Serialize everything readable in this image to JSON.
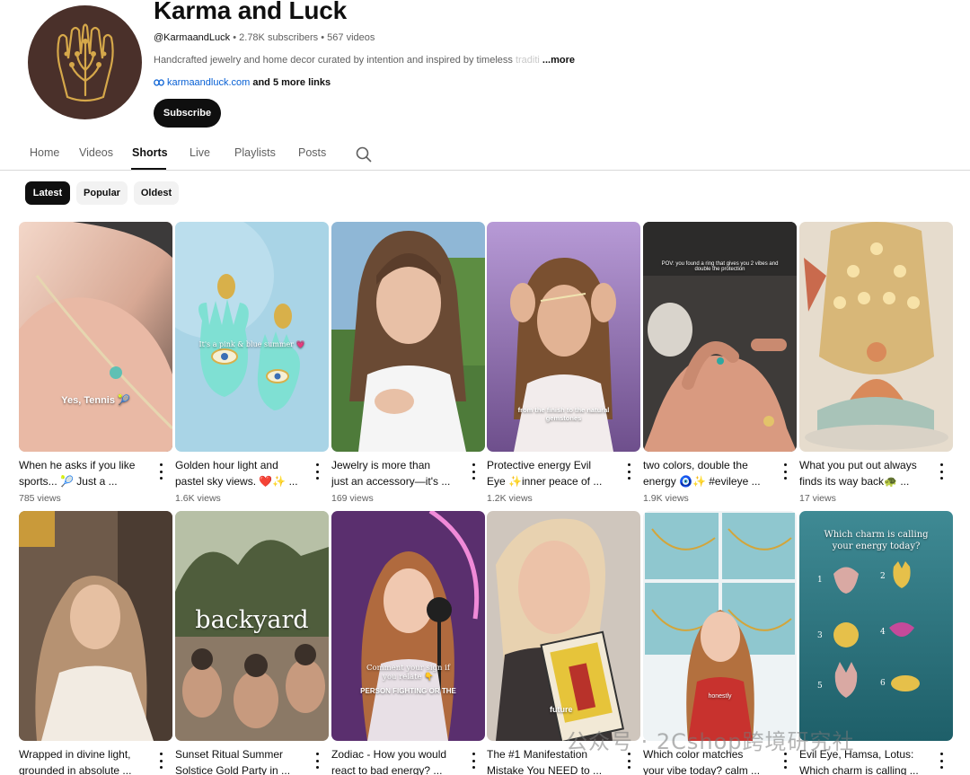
{
  "channel": {
    "name": "Karma and Luck",
    "handle": "@KarmaandLuck",
    "subscribers": "2.78K subscribers",
    "videos": "567 videos",
    "description_visible": "Handcrafted jewelry and home decor curated by intention and inspired by timeless ",
    "description_fade": "traditi",
    "more_label": "...more",
    "link_url": "karmaandluck.com",
    "link_more": "and 5 more links",
    "subscribe_label": "Subscribe",
    "avatar_icon": "hamsa-tree-logo-icon"
  },
  "tabs": [
    {
      "label": "Home"
    },
    {
      "label": "Videos"
    },
    {
      "label": "Shorts",
      "active": true
    },
    {
      "label": "Live"
    },
    {
      "label": "Playlists"
    },
    {
      "label": "Posts"
    }
  ],
  "filters": [
    {
      "label": "Latest",
      "active": true
    },
    {
      "label": "Popular"
    },
    {
      "label": "Oldest"
    }
  ],
  "shorts": [
    {
      "line1": "When he asks if you like",
      "line2": "sports... 🎾 Just a ...",
      "views": "785 views",
      "overlay": "Yes, Tennis 🎾"
    },
    {
      "line1": "Golden hour light and",
      "line2": "pastel sky views. ❤️✨ ...",
      "views": "1.6K views",
      "overlay": "It's a pink & blue summer 💗"
    },
    {
      "line1": "Jewelry is more than",
      "line2": "just an accessory—it's ...",
      "views": "169 views",
      "overlay": ""
    },
    {
      "line1": "Protective energy Evil",
      "line2": "Eye ✨inner peace of ...",
      "views": "1.2K views",
      "overlay": "from the finish to the natural gemstones"
    },
    {
      "line1": "two colors, double the",
      "line2": "energy 🧿✨ #evileye ...",
      "views": "1.9K views",
      "overlay": "POV: you found a ring that gives you 2 vibes and double the protection"
    },
    {
      "line1": "What you put out always",
      "line2": "finds its way back🐢 ...",
      "views": "17 views",
      "overlay": ""
    },
    {
      "line1": "Wrapped in divine light,",
      "line2": "grounded in absolute ...",
      "views": "",
      "overlay": ""
    },
    {
      "line1": "Sunset Ritual Summer",
      "line2": "Solstice Gold Party in ...",
      "views": "",
      "overlay": "backyard"
    },
    {
      "line1": "Zodiac - How you would",
      "line2": "react to bad energy? ...",
      "views": "",
      "overlay": "Comment your sign if you relate 👇"
    },
    {
      "line1": "The #1 Manifestation",
      "line2": "Mistake You NEED to ...",
      "views": "",
      "overlay": "future"
    },
    {
      "line1": "Which color matches",
      "line2": "your vibe today? calm ...",
      "views": "",
      "overlay": "honestly"
    },
    {
      "line1": "Evil Eye, Hamsa, Lotus:",
      "line2": "Which charm is calling ...",
      "views": "",
      "overlay": "Which charm is calling your energy today?"
    }
  ],
  "overlay_extra": {
    "zodiac_banner": "PERSON FIGHTING OR THE",
    "charm_numbers": [
      "1",
      "2",
      "3",
      "4",
      "5",
      "6"
    ]
  },
  "watermark": "公众号 · 2Cshop跨境研究社",
  "icons": {
    "search": "search-icon",
    "link": "link-icon",
    "more_vert": "more-vert-icon"
  }
}
